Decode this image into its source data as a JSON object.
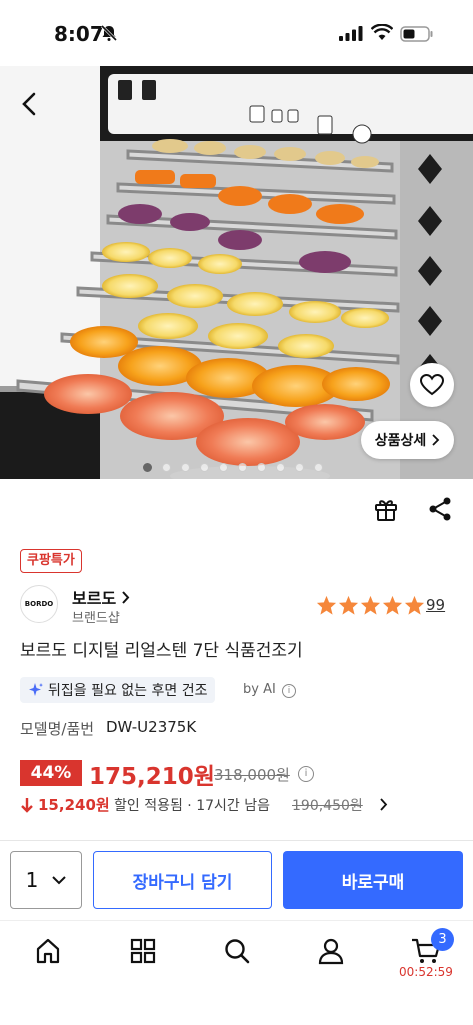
{
  "status_bar": {
    "time": "8:07"
  },
  "hero": {
    "detail_label": "상품상세",
    "dot_count": 10,
    "active_dot": 1
  },
  "product": {
    "badge": "쿠팡특가",
    "brand_name": "보르도",
    "brand_sub": "브랜드샵",
    "brand_logo_text": "BORDO",
    "rating": 5,
    "review_count": "99",
    "title": "보르도 디지털 리얼스텐 7단 식품건조기",
    "ai_summary": "뒤집을 필요 없는 후면 건조",
    "ai_by": "by AI",
    "model_label": "모델명/품번",
    "model_value": "DW-U2375K"
  },
  "price": {
    "discount": "44%",
    "sale": "175,210원",
    "original": "318,000원",
    "coupon_amount": "15,240원",
    "coupon_text": "할인 적용됨 · 17시간 남음",
    "coupon_original": "190,450원"
  },
  "buy_bar": {
    "quantity": "1",
    "cart_label": "장바구니 담기",
    "buy_label": "바로구매"
  },
  "tab_bar": {
    "cart_count": "3",
    "timer": "00:52:59"
  },
  "colors": {
    "accent": "#346aff",
    "sale": "#d9352e",
    "star": "#f5873b"
  }
}
